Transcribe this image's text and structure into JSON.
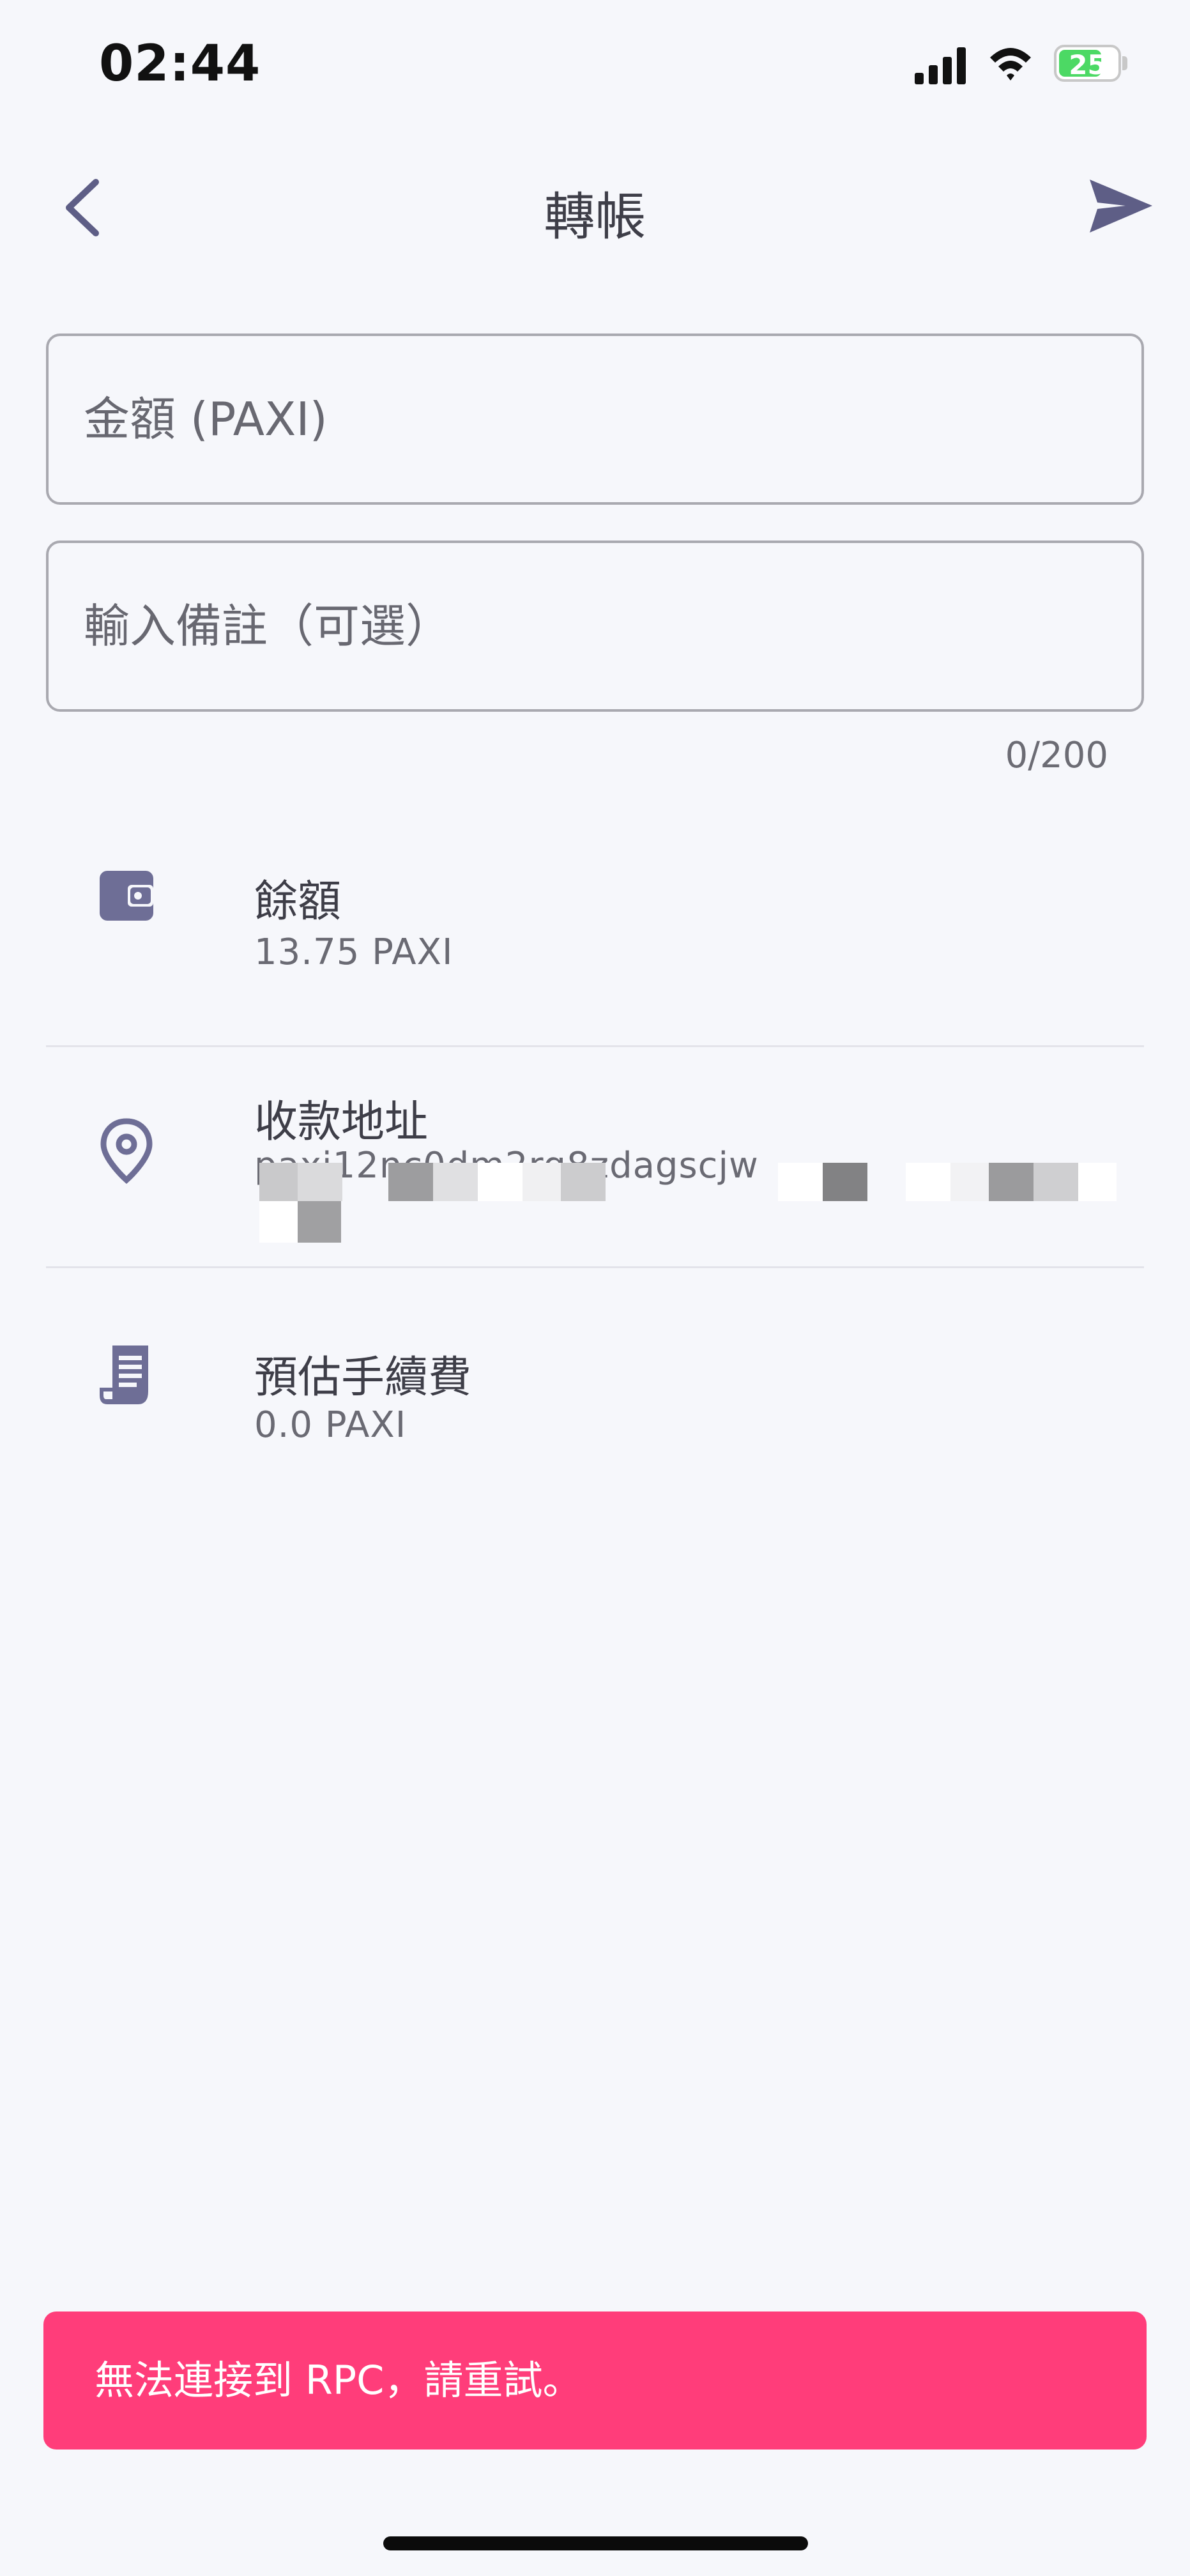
{
  "status_bar": {
    "time": "02:44",
    "battery": "25"
  },
  "header": {
    "title": "轉帳"
  },
  "form": {
    "amount_placeholder": "金額 (PAXI)",
    "memo_placeholder": "輸入備註（可選）",
    "memo_counter": "0/200"
  },
  "rows": {
    "balance": {
      "label": "餘額",
      "value": "13.75 PAXI"
    },
    "address": {
      "label": "收款地址",
      "value": "paxi12nc0dm2rg8zdagscjw"
    },
    "fee": {
      "label": "預估手續費",
      "value": "0.0 PAXI"
    }
  },
  "toast": {
    "message": "無法連接到 RPC，請重試。"
  },
  "colors": {
    "accent": "#6E6E96",
    "toast": "#FF3D7A",
    "background": "#F6F7FB"
  }
}
